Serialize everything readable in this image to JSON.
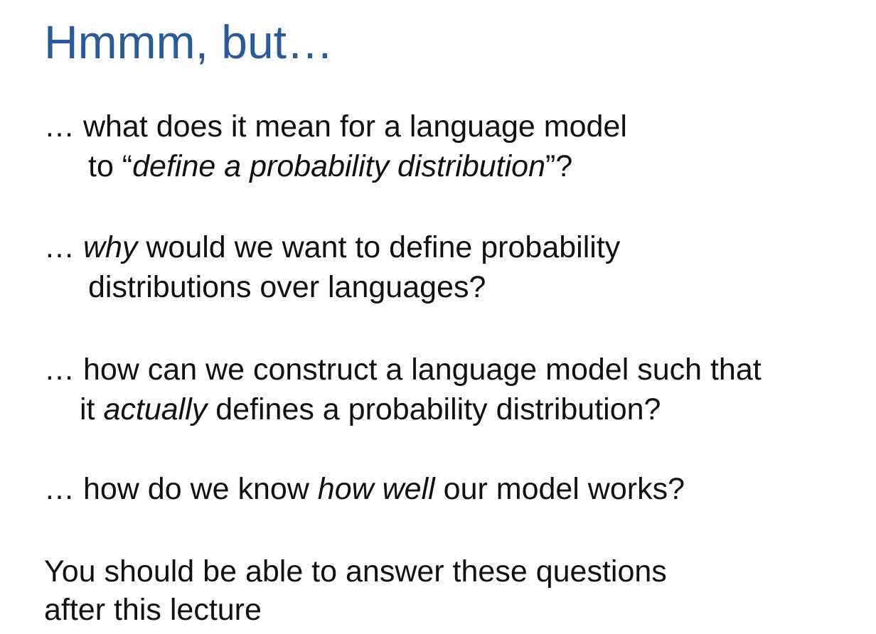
{
  "slide": {
    "title": "Hmmm, but…",
    "questions": [
      {
        "line1": {
          "prefix": "… what does it mean for a language model",
          "italic": "",
          "suffix": ""
        },
        "line2": {
          "prefix": "to “",
          "italic": "define a probability distribution",
          "suffix": "”?"
        }
      },
      {
        "line1": {
          "prefix": "… ",
          "italic": "why",
          "suffix": " would we want to define probability"
        },
        "line2": {
          "prefix": "distributions over languages?",
          "italic": "",
          "suffix": ""
        }
      },
      {
        "line1": {
          "prefix": "… how can we construct a language model such that",
          "italic": "",
          "suffix": ""
        },
        "line2": {
          "prefix": "it ",
          "italic": "actually",
          "suffix": " defines a probability distribution?"
        }
      },
      {
        "line1": {
          "prefix": "… how do we know ",
          "italic": "how well",
          "suffix": " our model works?"
        }
      }
    ],
    "closing": {
      "line1": "You should be able to answer these questions",
      "line2": "after this lecture"
    }
  }
}
